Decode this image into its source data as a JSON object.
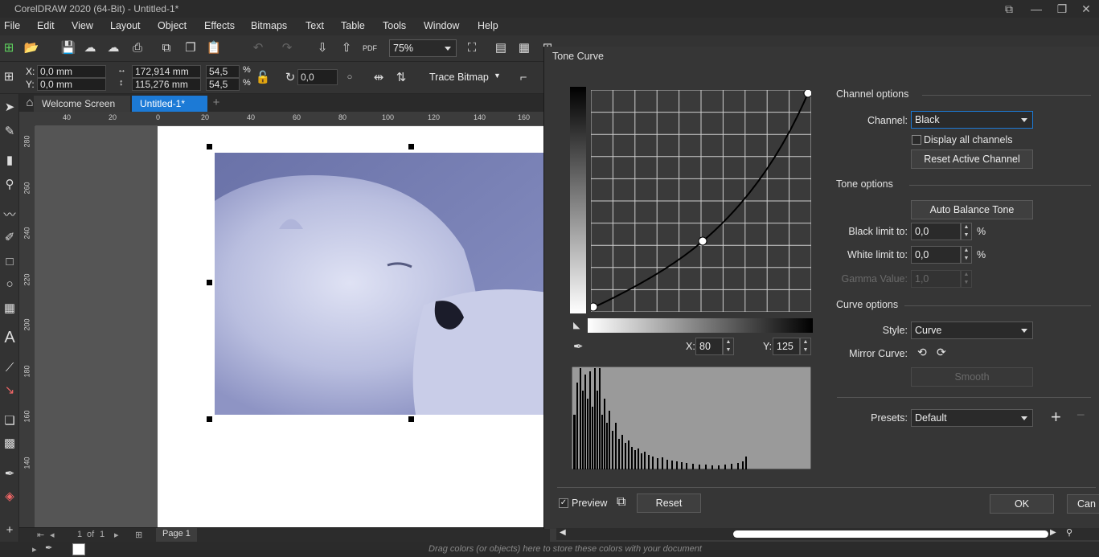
{
  "app": {
    "title": "CorelDRAW 2020 (64-Bit) - Untitled-1*"
  },
  "menu": [
    "File",
    "Edit",
    "View",
    "Layout",
    "Object",
    "Effects",
    "Bitmaps",
    "Text",
    "Table",
    "Tools",
    "Window",
    "Help"
  ],
  "toolbar": {
    "zoom": "75%"
  },
  "props": {
    "x": "0,0 mm",
    "y": "0,0 mm",
    "w": "172,914 mm",
    "h": "115,276 mm",
    "sx": "54,5",
    "sy": "54,5",
    "pct": "%",
    "angle": "0,0",
    "trace": "Trace Bitmap",
    "xl": "X:",
    "yl": "Y:"
  },
  "tabs": {
    "welcome": "Welcome Screen",
    "doc": "Untitled-1*"
  },
  "ruler": {
    "h": [
      "40",
      "20",
      "0",
      "20",
      "40",
      "60",
      "80",
      "100",
      "120",
      "140",
      "160"
    ],
    "v": [
      "280",
      "260",
      "240",
      "220",
      "200",
      "180",
      "160",
      "140"
    ]
  },
  "status": {
    "page": "Page 1",
    "pagenum": "1",
    "of": "of",
    "total": "1"
  },
  "colorbar": {
    "hint": "Drag colors (or objects) here to store these colors with your document"
  },
  "dialog": {
    "title": "Tone Curve",
    "channel_options": "Channel options",
    "channel_label": "Channel:",
    "channel_value": "Black",
    "display_all": "Display all channels",
    "reset_channel": "Reset Active Channel",
    "tone_options": "Tone options",
    "auto_balance": "Auto Balance Tone",
    "black_limit_label": "Black limit to:",
    "black_limit": "0,0",
    "white_limit_label": "White limit to:",
    "white_limit": "0,0",
    "gamma_label": "Gamma Value:",
    "gamma": "1,0",
    "pct": "%",
    "curve_options": "Curve options",
    "style_label": "Style:",
    "style_value": "Curve",
    "mirror_label": "Mirror Curve:",
    "smooth": "Smooth",
    "presets_label": "Presets:",
    "presets_value": "Default",
    "x_label": "X:",
    "x_value": "80",
    "y_label": "Y:",
    "y_value": "125",
    "preview": "Preview",
    "reset": "Reset",
    "ok": "OK",
    "cancel": "Can"
  },
  "colors": {
    "accent": "#1c7ad6",
    "dialog_bg": "#363636",
    "curve_bg": "#3a3a3a"
  }
}
